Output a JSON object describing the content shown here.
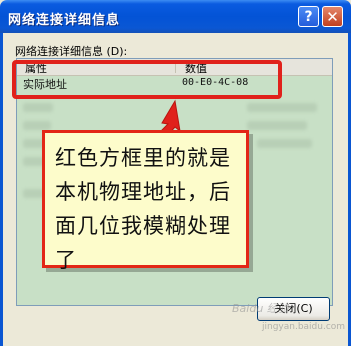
{
  "window": {
    "title": "网络连接详细信息",
    "help_glyph": "?",
    "close_glyph": "✕"
  },
  "group_label": "网络连接详细信息 (D):",
  "list": {
    "columns": [
      "属性",
      "数值"
    ],
    "rows": [
      {
        "property": "实际地址",
        "value": "00-E0-4C-08"
      }
    ]
  },
  "callout": {
    "text": "红色方框里的就是本机物理地址，后面几位我模糊处理了"
  },
  "buttons": {
    "close_label": "关闭(C)"
  },
  "watermark": {
    "text": "Baidu 经验",
    "url": "jingyan.baidu.com"
  },
  "colors": {
    "titlebar": "#0353d6",
    "highlight": "#e0211b",
    "callout_bg": "#fdfccb",
    "list_bg": "#c8e0c6"
  }
}
